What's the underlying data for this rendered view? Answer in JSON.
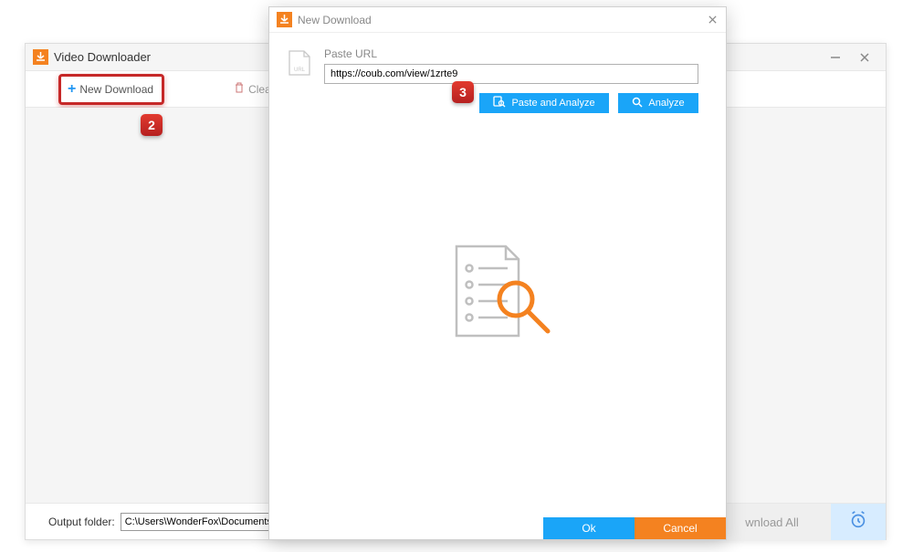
{
  "main": {
    "title": "Video Downloader",
    "new_download_label": "New Download",
    "clear_label": "Clear",
    "output_folder_label": "Output folder:",
    "output_folder_value": "C:\\Users\\WonderFox\\Documents\\Wonder",
    "download_all_label": "wnload All"
  },
  "dialog": {
    "title": "New Download",
    "paste_url_label": "Paste URL",
    "url_value": "https://coub.com/view/1zrte9",
    "paste_analyze_label": "Paste and Analyze",
    "analyze_label": "Analyze",
    "ok_label": "Ok",
    "cancel_label": "Cancel"
  },
  "annotations": {
    "badge2": "2",
    "badge3": "3"
  }
}
